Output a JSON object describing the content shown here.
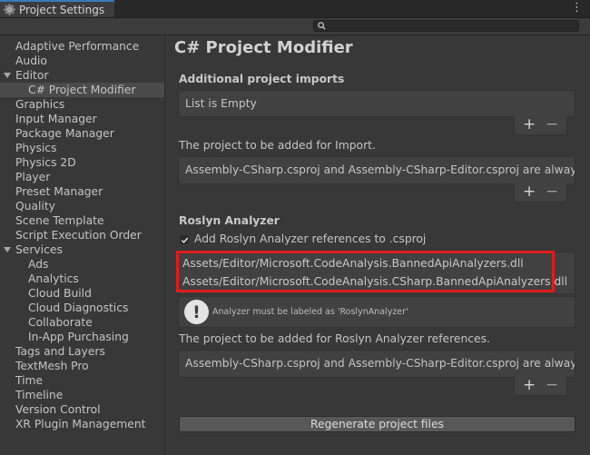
{
  "window": {
    "tab_title": "Project Settings",
    "menu_icon": "kebab-menu-icon",
    "tab_icon": "gear-icon",
    "search": {
      "value": "",
      "icon": "search-icon"
    }
  },
  "sidebar": {
    "items": [
      {
        "label": "Adaptive Performance",
        "indent": 0
      },
      {
        "label": "Audio",
        "indent": 0
      },
      {
        "label": "Editor",
        "indent": 0,
        "expandable": true
      },
      {
        "label": "C# Project Modifier",
        "indent": 1,
        "selected": true
      },
      {
        "label": "Graphics",
        "indent": 0
      },
      {
        "label": "Input Manager",
        "indent": 0
      },
      {
        "label": "Package Manager",
        "indent": 0
      },
      {
        "label": "Physics",
        "indent": 0
      },
      {
        "label": "Physics 2D",
        "indent": 0
      },
      {
        "label": "Player",
        "indent": 0
      },
      {
        "label": "Preset Manager",
        "indent": 0
      },
      {
        "label": "Quality",
        "indent": 0
      },
      {
        "label": "Scene Template",
        "indent": 0
      },
      {
        "label": "Script Execution Order",
        "indent": 0
      },
      {
        "label": "Services",
        "indent": 0,
        "expandable": true
      },
      {
        "label": "Ads",
        "indent": 1
      },
      {
        "label": "Analytics",
        "indent": 1
      },
      {
        "label": "Cloud Build",
        "indent": 1
      },
      {
        "label": "Cloud Diagnostics",
        "indent": 1
      },
      {
        "label": "Collaborate",
        "indent": 1
      },
      {
        "label": "In-App Purchasing",
        "indent": 1
      },
      {
        "label": "Tags and Layers",
        "indent": 0
      },
      {
        "label": "TextMesh Pro",
        "indent": 0
      },
      {
        "label": "Time",
        "indent": 0
      },
      {
        "label": "Timeline",
        "indent": 0
      },
      {
        "label": "Version Control",
        "indent": 0
      },
      {
        "label": "XR Plugin Management",
        "indent": 0
      }
    ]
  },
  "main": {
    "title": "C# Project Modifier",
    "imports_header": "Additional project imports",
    "imports_list_text": "List is Empty",
    "import_desc_label": "The project to be added for Import.",
    "import_desc_value": "Assembly-CSharp.csproj and Assembly-CSharp-Editor.csproj are always target.",
    "roslyn_header": "Roslyn Analyzer",
    "roslyn_checkbox_label": "Add Roslyn Analyzer references to .csproj",
    "roslyn_checkbox_checked": true,
    "dll_items": [
      "Assets/Editor/Microsoft.CodeAnalysis.BannedApiAnalyzers.dll",
      "Assets/Editor/Microsoft.CodeAnalysis.CSharp.BannedApiAnalyzers.dll"
    ],
    "help_message": "Analyzer must be labeled as 'RoslynAnalyzer'",
    "analyzer_desc_label": "The project to be added for Roslyn Analyzer references.",
    "analyzer_desc_value": "Assembly-CSharp.csproj and Assembly-CSharp-Editor.csproj are always target.",
    "regenerate_button": "Regenerate project files",
    "plus": "+",
    "minus": "−",
    "colors": {
      "highlight": "#e01c1c",
      "accent": "#3a79bb"
    }
  }
}
